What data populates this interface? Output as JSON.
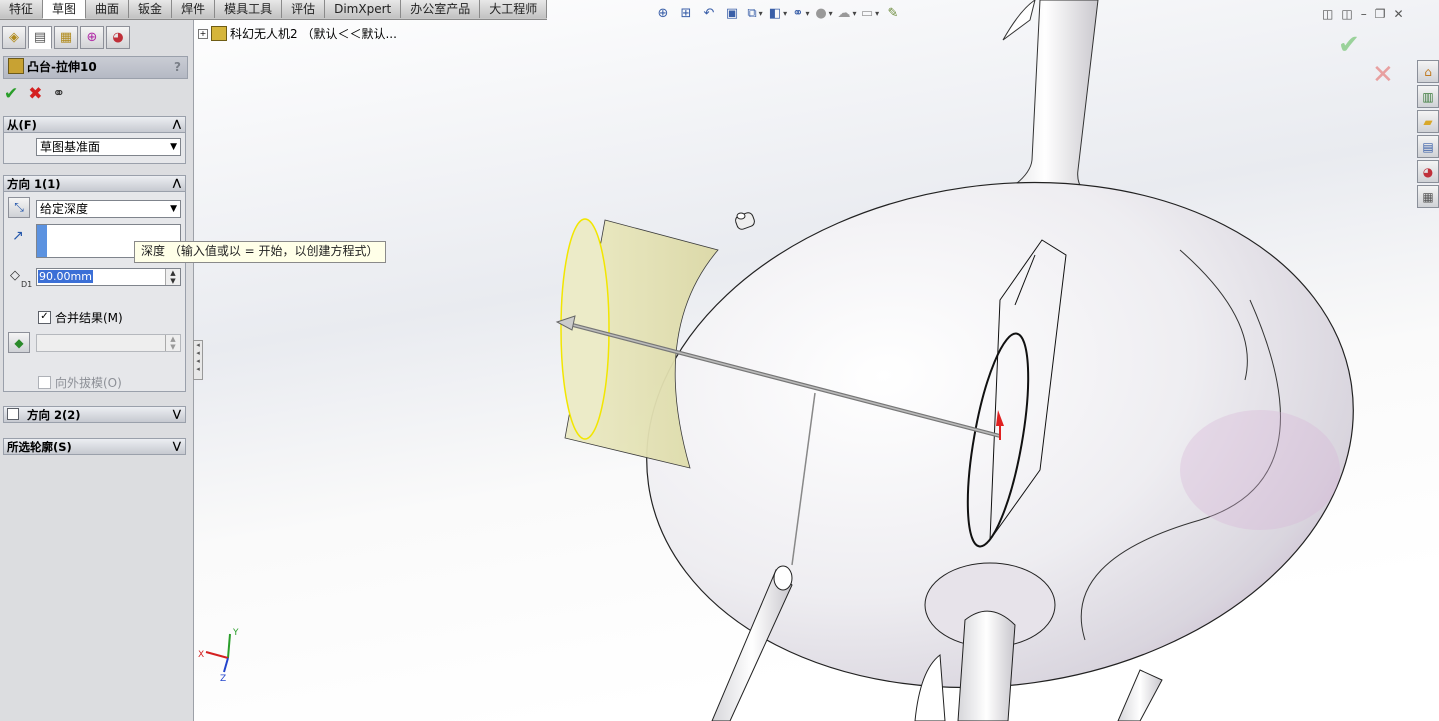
{
  "command_tabs": [
    {
      "label": "特征",
      "active": false
    },
    {
      "label": "草图",
      "active": true
    },
    {
      "label": "曲面",
      "active": false
    },
    {
      "label": "钣金",
      "active": false
    },
    {
      "label": "焊件",
      "active": false
    },
    {
      "label": "模具工具",
      "active": false
    },
    {
      "label": "评估",
      "active": false
    },
    {
      "label": "DimXpert",
      "active": false
    },
    {
      "label": "办公室产品",
      "active": false
    },
    {
      "label": "大工程师",
      "active": false
    }
  ],
  "property_manager": {
    "tab_icons": [
      "feature-manager-icon",
      "property-manager-icon",
      "configuration-manager-icon",
      "dimxpert-manager-icon",
      "display-manager-icon"
    ],
    "title": "凸台-拉伸10",
    "help": "?",
    "from_group": {
      "header": "从(F)",
      "start_condition": "草图基准面"
    },
    "direction1_group": {
      "header": "方向 1(1)",
      "end_condition": "给定深度",
      "depth_value": "90.00mm",
      "depth_icon_label": "D1",
      "merge_result_label": "合并结果(M)",
      "merge_result_checked": true,
      "draft_outward_label": "向外拔模(O)",
      "draft_outward_checked": false
    },
    "direction2_group": {
      "header": "方向 2(2)",
      "checked": false
    },
    "selected_contours_group": {
      "header": "所选轮廓(S)"
    }
  },
  "tooltip": "深度 （输入值或以 = 开始，以创建方程式）",
  "feature_tree": {
    "part_label": "科幻无人机2 （默认＜＜默认..."
  },
  "triad": {
    "x": "X",
    "y": "Y",
    "z": "Z"
  },
  "colors": {
    "extrude_preview": "#e6e4b4",
    "extrude_edge": "#f2e600",
    "body_shade": "#d8d6dc",
    "accent_pink": "#d8b4d8",
    "selection_blue": "#3b6fd6"
  }
}
